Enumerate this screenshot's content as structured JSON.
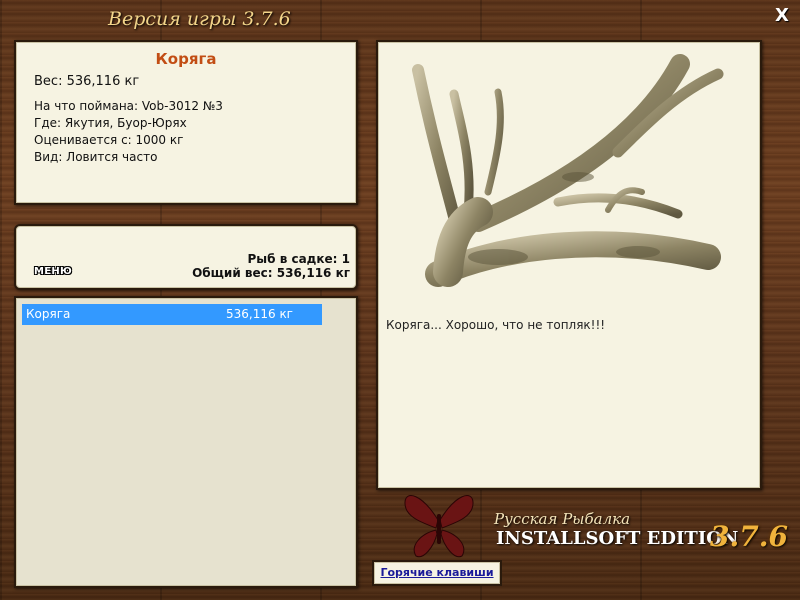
{
  "window": {
    "title": "Версия игры 3.7.6",
    "close_label": "X"
  },
  "catch_info": {
    "name": "Коряга",
    "weight": "Вес: 536,116 кг",
    "details": [
      "На что поймана: Vob-3012 №3",
      "Где: Якутия, Буор-Юрях",
      "Оценивается с: 1000 кг",
      "Вид: Ловится часто"
    ]
  },
  "keepnet": {
    "menu_label": "МЕНЮ",
    "count": "Рыб в садке: 1",
    "total": "Общий вес: 536,116 кг"
  },
  "catch_list": [
    {
      "name": "Коряга",
      "weight": "536,116 кг"
    }
  ],
  "catch_photo": {
    "comment": "Коряга... Хорошо, что не топляк!!!"
  },
  "branding": {
    "game": "Русская Рыбалка",
    "edition": "INSTALLSOFT EDITION",
    "version": "3.7.6"
  },
  "hotkeys_link": "Горячие клавиши",
  "colors": {
    "accent_name": "#c24d14",
    "selection": "#3399ff",
    "panel": "#f6f3e2",
    "version": "#f0b33c"
  },
  "icons": [
    "butterfly-logo-icon",
    "driftwood-photo"
  ]
}
